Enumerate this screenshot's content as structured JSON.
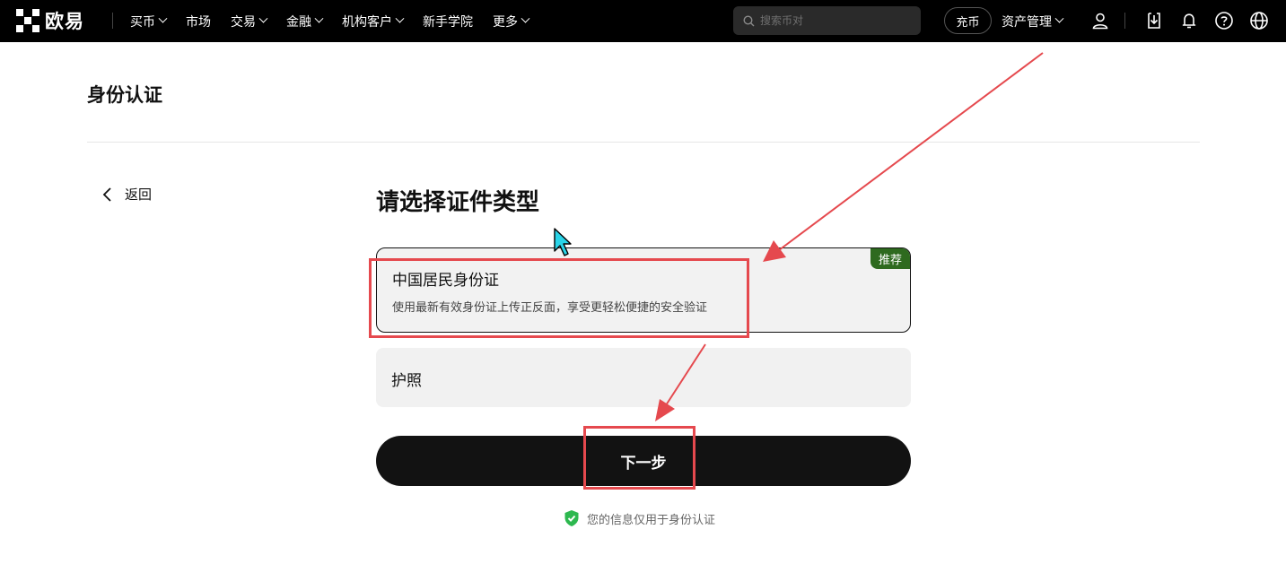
{
  "header": {
    "logo_text": "欧易",
    "nav": [
      {
        "label": "买币",
        "dropdown": true
      },
      {
        "label": "市场",
        "dropdown": false
      },
      {
        "label": "交易",
        "dropdown": true
      },
      {
        "label": "金融",
        "dropdown": true
      },
      {
        "label": "机构客户",
        "dropdown": true
      },
      {
        "label": "新手学院",
        "dropdown": false
      },
      {
        "label": "更多",
        "dropdown": true
      }
    ],
    "search_placeholder": "搜索币对",
    "deposit_label": "充币",
    "assets_label": "资产管理",
    "icons": [
      "user-icon",
      "download-icon",
      "bell-icon",
      "help-icon",
      "globe-icon"
    ]
  },
  "page": {
    "title": "身份认证",
    "back_label": "返回",
    "heading": "请选择证件类型",
    "options": [
      {
        "title": "中国居民身份证",
        "desc": "使用最新有效身份证上传正反面，享受更轻松便捷的安全验证",
        "badge": "推荐",
        "selected": true
      },
      {
        "title": "护照",
        "selected": false
      }
    ],
    "next_label": "下一步",
    "privacy_note": "您的信息仅用于身份认证"
  },
  "colors": {
    "annotation_red": "#e5494e",
    "badge_green": "#2e6a1f",
    "shield_green": "#2db84f",
    "cursor_cyan": "#2ad4e8"
  }
}
